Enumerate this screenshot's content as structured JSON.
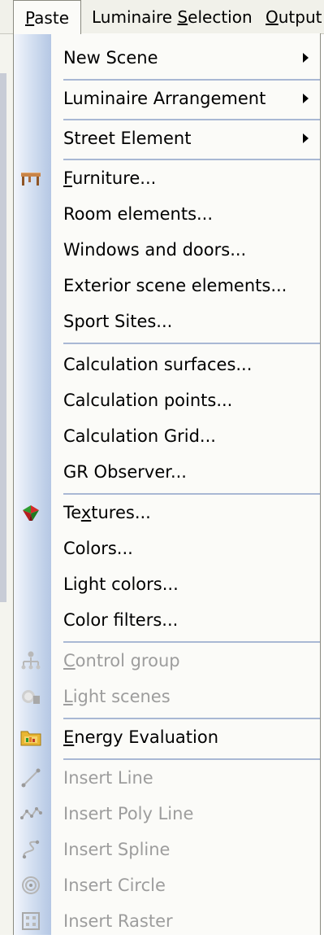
{
  "menubar": {
    "active": {
      "prefix": "",
      "key": "P",
      "rest": "aste"
    },
    "lum": {
      "prefix": "Luminaire ",
      "key": "S",
      "rest": "election"
    },
    "output": {
      "prefix": "",
      "key": "O",
      "rest": "utput"
    }
  },
  "menu": {
    "new_scene": {
      "prefix": "New Scene",
      "key": "",
      "rest": ""
    },
    "luminaire_arrangement": {
      "prefix": "Luminaire Arrangement",
      "key": "",
      "rest": ""
    },
    "street_element": {
      "prefix": "Street Element",
      "key": "",
      "rest": ""
    },
    "furniture": {
      "prefix": "",
      "key": "F",
      "rest": "urniture..."
    },
    "room_elements": {
      "prefix": "Room elements...",
      "key": "",
      "rest": ""
    },
    "windows_doors": {
      "prefix": "Windows and doors...",
      "key": "",
      "rest": ""
    },
    "exterior": {
      "prefix": "Exterior scene elements...",
      "key": "",
      "rest": ""
    },
    "sport_sites": {
      "prefix": "Sport Sites...",
      "key": "",
      "rest": ""
    },
    "calc_surfaces": {
      "prefix": "Calculation surfaces...",
      "key": "",
      "rest": ""
    },
    "calc_points": {
      "prefix": "Calculation points...",
      "key": "",
      "rest": ""
    },
    "calc_grid": {
      "prefix": "Calculation Grid...",
      "key": "",
      "rest": ""
    },
    "gr_observer": {
      "prefix": "GR Observer...",
      "key": "",
      "rest": ""
    },
    "textures": {
      "prefix": "Te",
      "key": "x",
      "rest": "tures..."
    },
    "colors": {
      "prefix": "Colors...",
      "key": "",
      "rest": ""
    },
    "light_colors": {
      "prefix": "Light colors...",
      "key": "",
      "rest": ""
    },
    "color_filters": {
      "prefix": "Color filters...",
      "key": "",
      "rest": ""
    },
    "control_group": {
      "prefix": "",
      "key": "C",
      "rest": "ontrol group"
    },
    "light_scenes": {
      "prefix": "",
      "key": "L",
      "rest": "ight scenes"
    },
    "energy_eval": {
      "prefix": "",
      "key": "E",
      "rest": "nergy Evaluation"
    },
    "insert_line": {
      "prefix": "Insert Line",
      "key": "",
      "rest": ""
    },
    "insert_polyline": {
      "prefix": "Insert Poly Line",
      "key": "",
      "rest": ""
    },
    "insert_spline": {
      "prefix": "Insert Spline",
      "key": "",
      "rest": ""
    },
    "insert_circle": {
      "prefix": "Insert Circle",
      "key": "",
      "rest": ""
    },
    "insert_raster": {
      "prefix": "Insert Raster",
      "key": "",
      "rest": ""
    }
  },
  "icons": {
    "furniture": "table-icon",
    "textures": "texture-cube-icon",
    "control_group": "control-group-icon",
    "light_scenes": "light-scene-icon",
    "energy_eval": "energy-folder-icon",
    "insert_line": "line-tool-icon",
    "insert_polyline": "polyline-tool-icon",
    "insert_spline": "spline-tool-icon",
    "insert_circle": "circle-tool-icon",
    "insert_raster": "raster-tool-icon"
  },
  "colors": {
    "rail_gradient_end": "#b5c7e4",
    "separator": "#a9b8d4",
    "disabled_text": "#9d9d9d",
    "menu_bg": "#fbfbf8"
  }
}
